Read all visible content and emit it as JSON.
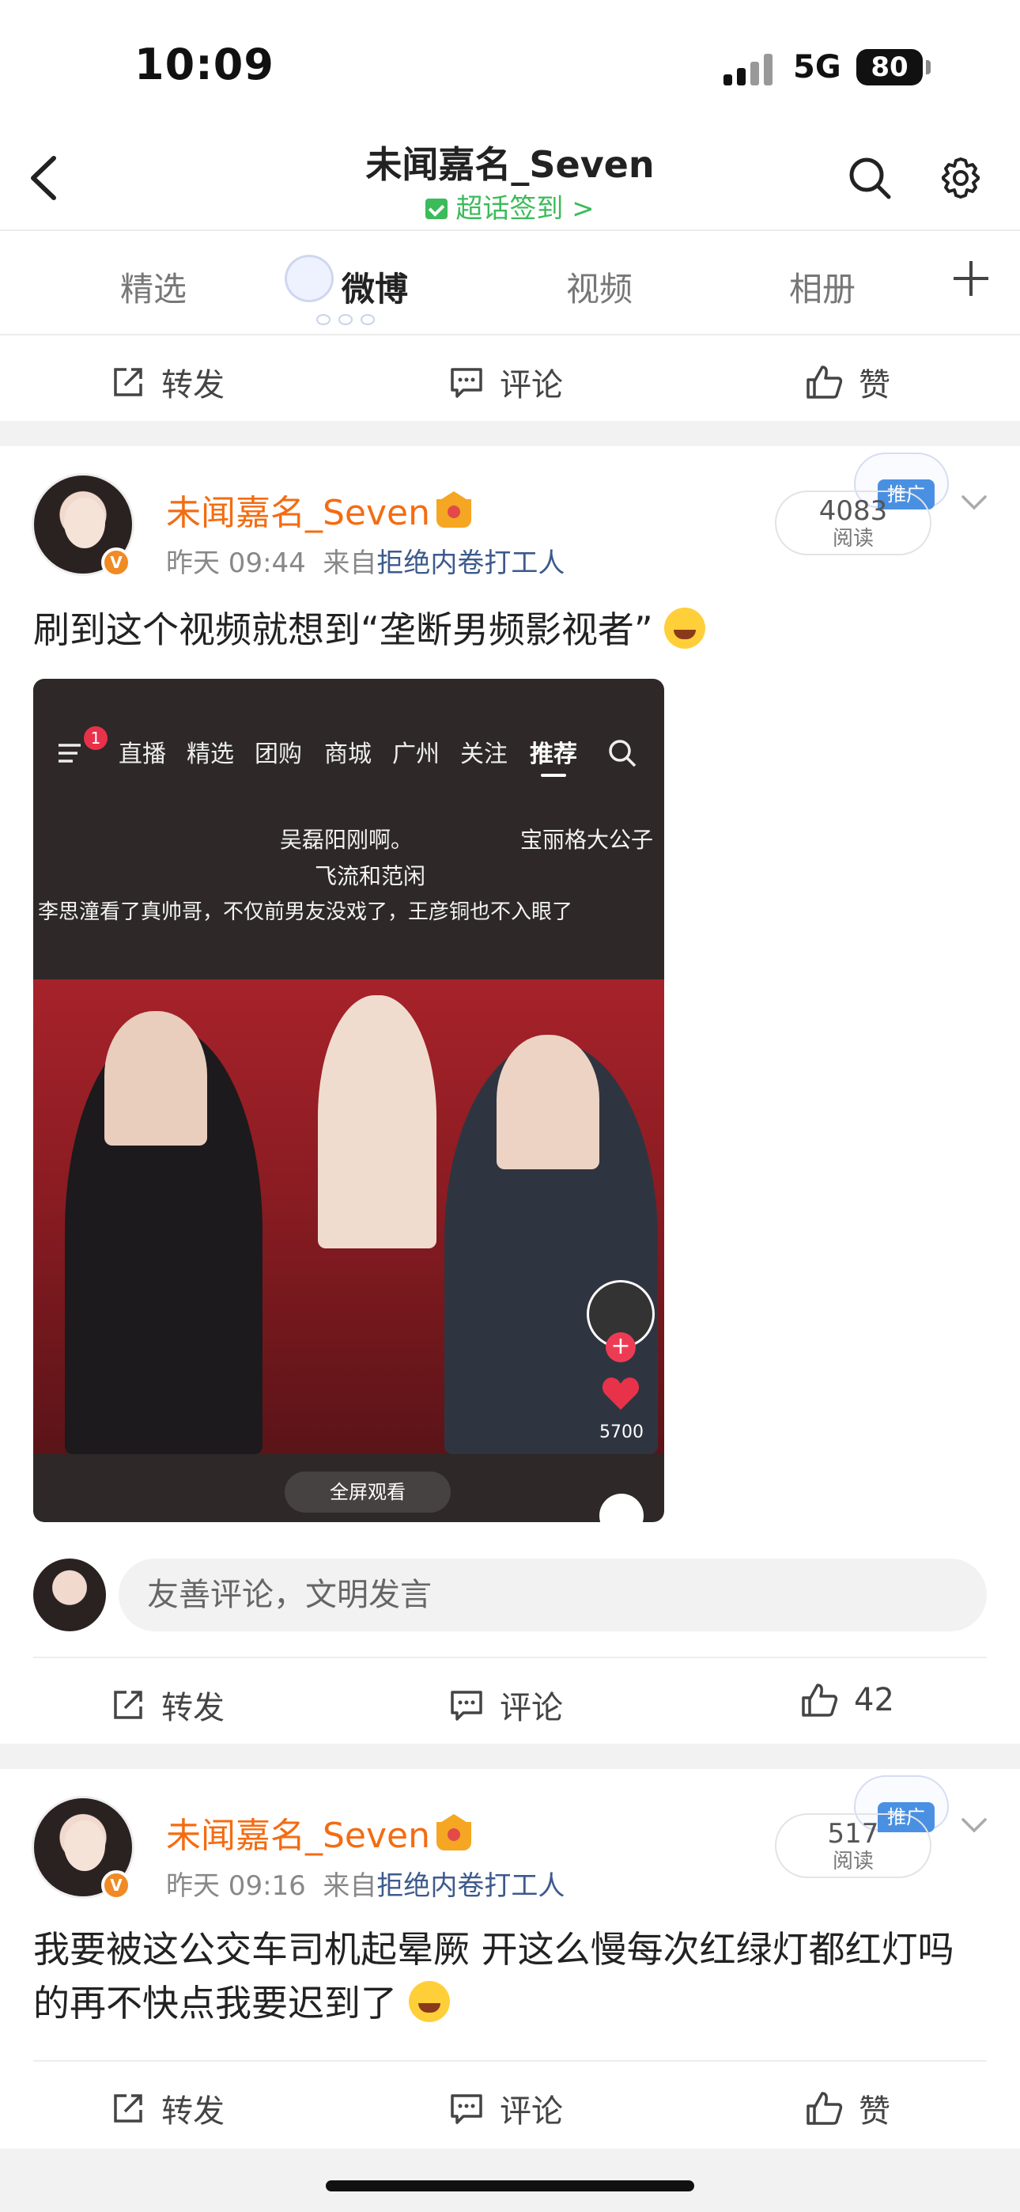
{
  "status": {
    "time": "10:09",
    "network": "5G",
    "battery": "80"
  },
  "header": {
    "title": "未闻嘉名_Seven",
    "subtitle": "超话签到 >"
  },
  "tabs": [
    {
      "label": "精选"
    },
    {
      "label": "微博"
    },
    {
      "label": "视频"
    },
    {
      "label": "相册"
    }
  ],
  "actions": {
    "repost": "转发",
    "comment": "评论",
    "like": "赞"
  },
  "posts": [
    {
      "username": "未闻嘉名_Seven",
      "time": "昨天 09:44",
      "from_prefix": "来自",
      "source": "拒绝内卷打工人",
      "read_count": "4083",
      "read_label": "阅读",
      "promo": "推广",
      "text": "刷到这个视频就想到“垄断男频影视者”",
      "like_count": "42",
      "video": {
        "nav": [
          "直播",
          "精选",
          "团购",
          "商城",
          "广州",
          "关注",
          "推荐"
        ],
        "notif_count": "1",
        "comments": [
          "吴磊阳刚啊。",
          "宝丽格大公子",
          "飞流和范闲",
          "李思潼看了真帅哥，不仅前男友没戏了，王彦铜也不入眼了"
        ],
        "likes": "5700",
        "fullscreen": "全屏观看"
      }
    },
    {
      "username": "未闻嘉名_Seven",
      "time": "昨天 09:16",
      "from_prefix": "来自",
      "source": "拒绝内卷打工人",
      "read_count": "517",
      "read_label": "阅读",
      "promo": "推广",
      "text": "我要被这公交车司机起晕厥 开这么慢每次红绿灯都红灯吗的再不快点我要迟到了"
    }
  ],
  "comment_box": {
    "placeholder": "友善评论，文明发言"
  },
  "colors": {
    "accent": "#f46c12",
    "source_link": "#3d5a8c",
    "checkin": "#3cbb5a",
    "promo": "#4a90e2"
  }
}
